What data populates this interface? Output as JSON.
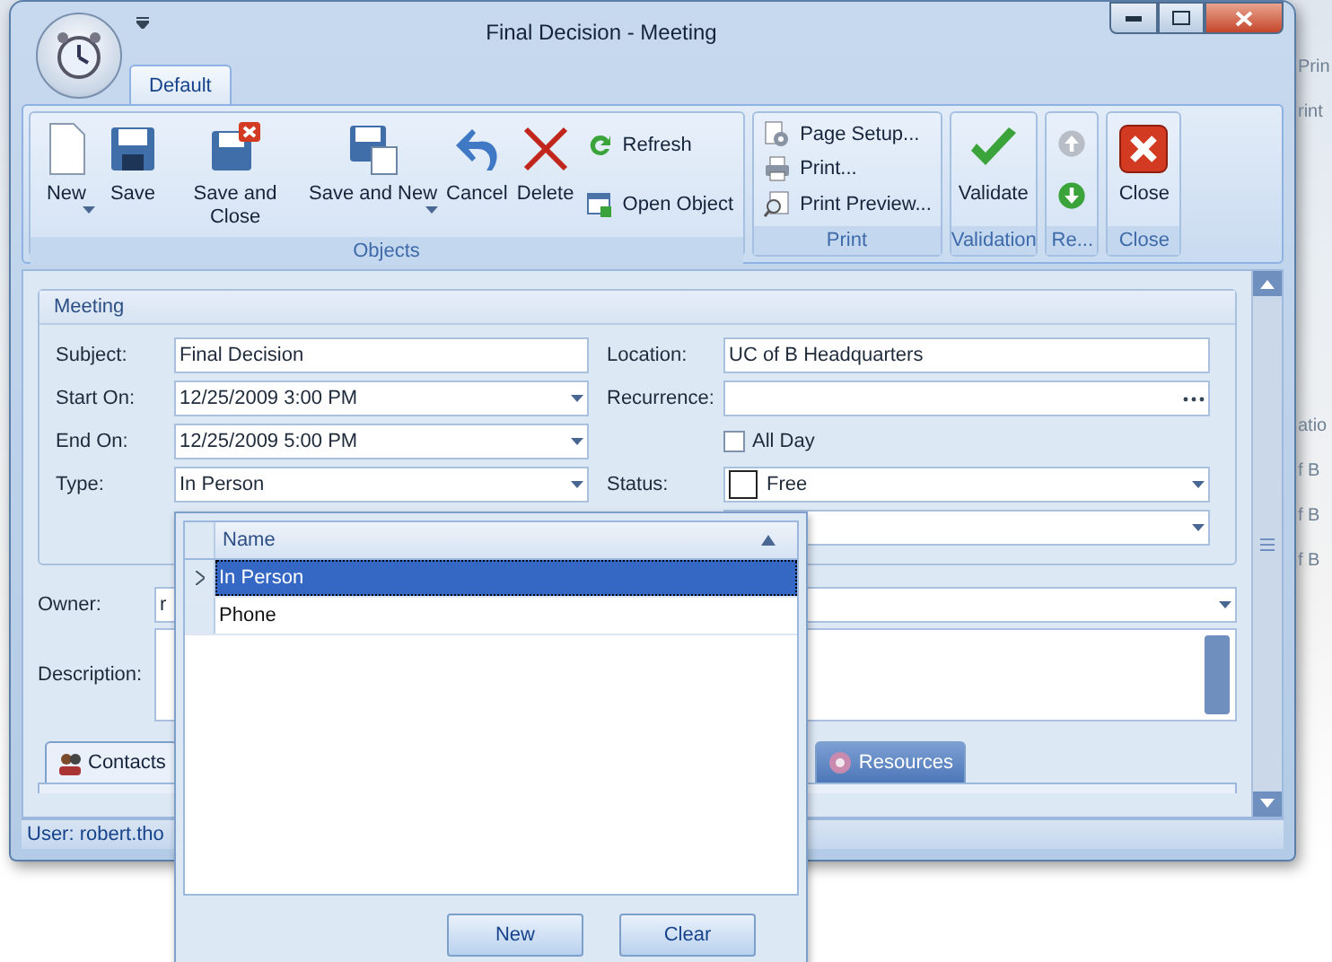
{
  "window": {
    "title": "Final Decision - Meeting"
  },
  "ribbon_tabs": [
    {
      "label": "Default",
      "selected": true
    }
  ],
  "ribbon_groups": [
    {
      "label": "Objects",
      "items": [
        {
          "kind": "large",
          "label": "New",
          "dropdown": true,
          "disabled": false
        },
        {
          "kind": "large",
          "label": "Save",
          "dropdown": false,
          "disabled": false
        },
        {
          "kind": "large",
          "label": "Save and Close",
          "dropdown": false,
          "disabled": false
        },
        {
          "kind": "large",
          "label": "Save and New",
          "dropdown": true,
          "disabled": false
        },
        {
          "kind": "large",
          "label": "Cancel",
          "dropdown": false,
          "disabled": false
        },
        {
          "kind": "large",
          "label": "Delete",
          "dropdown": false,
          "disabled": false
        },
        {
          "kind": "small",
          "label": "Refresh",
          "disabled": false
        },
        {
          "kind": "small",
          "label": "Open Object",
          "disabled": false
        }
      ]
    },
    {
      "label": "Print",
      "items": [
        {
          "kind": "small",
          "label": "Page Setup...",
          "disabled": false
        },
        {
          "kind": "small",
          "label": "Print...",
          "disabled": false
        },
        {
          "kind": "small",
          "label": "Print Preview...",
          "disabled": false
        }
      ]
    },
    {
      "label": "Validation",
      "items": [
        {
          "kind": "large",
          "label": "Validate",
          "dropdown": false,
          "disabled": false
        }
      ]
    },
    {
      "label": "Re...",
      "items": [
        {
          "kind": "icon",
          "disabled": true
        },
        {
          "kind": "icon",
          "disabled": false
        }
      ]
    },
    {
      "label": "Close",
      "items": [
        {
          "kind": "large",
          "label": "Close",
          "dropdown": false,
          "disabled": false
        }
      ]
    }
  ],
  "meeting": {
    "title": "Meeting",
    "left": [
      {
        "label": "Subject:",
        "value": "Final Decision",
        "kind": "text"
      },
      {
        "label": "Start On:",
        "value": "12/25/2009 3:00 PM",
        "kind": "combo"
      },
      {
        "label": "End On:",
        "value": "12/25/2009 5:00 PM",
        "kind": "combo"
      },
      {
        "label": "Type:",
        "value": "In Person",
        "kind": "combo"
      }
    ],
    "right": [
      {
        "label": "Location:",
        "value": "UC of B Headquarters",
        "kind": "text"
      },
      {
        "label": "Recurrence:",
        "kind": "ellipsis"
      },
      {
        "label": "All Day",
        "kind": "checkbox",
        "checked": false
      },
      {
        "label": "Status:",
        "value": "Free",
        "kind": "status"
      },
      {
        "kind": "combo"
      }
    ]
  },
  "owner": {
    "label": "Owner:",
    "value": "r"
  },
  "description": {
    "label": "Description:"
  },
  "detail_tabs": [
    {
      "label": "Contacts",
      "selected": true
    },
    {
      "label": "Resources",
      "selected": false
    }
  ],
  "status_bar": {
    "text": "User: robert.tho"
  },
  "background_window": {
    "texts": [
      "Prin",
      "rint",
      "atio",
      "f B",
      "f B",
      "f B"
    ]
  },
  "type_popup": {
    "column": "Name",
    "rows": [
      {
        "name": "In Person",
        "selected": true
      },
      {
        "name": "Phone",
        "selected": false
      }
    ],
    "buttons": [
      "New",
      "Clear"
    ]
  }
}
